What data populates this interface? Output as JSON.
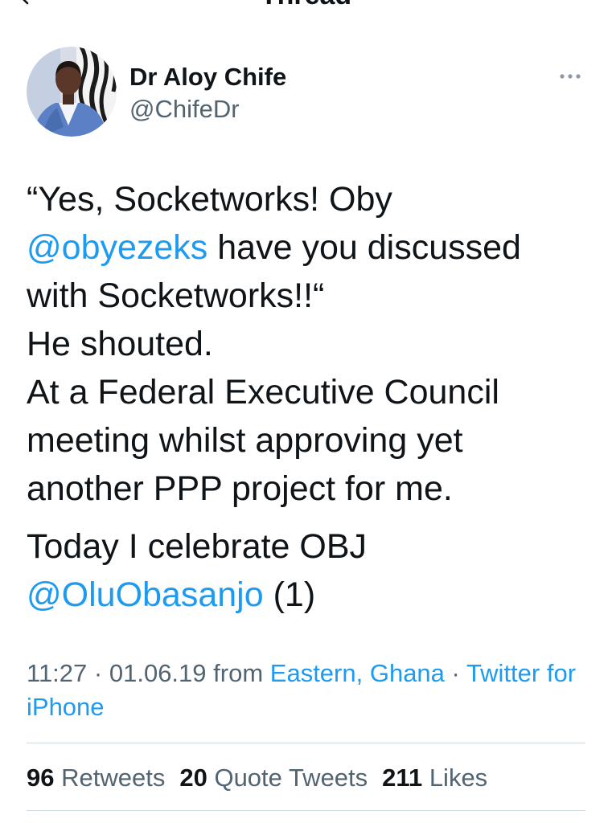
{
  "header": {
    "title": "Thread"
  },
  "author": {
    "name": "Dr Aloy Chife",
    "handle": "@ChifeDr"
  },
  "tweet": {
    "paragraph_1": {
      "line_1": "“Yes, Socketworks! Oby",
      "line_2_mention": "@obyezeks",
      "line_2_text": "have you discussed",
      "line_3": "with Socketworks!!“",
      "line_4": "He shouted.",
      "line_5": "At a Federal Executive Council",
      "line_6": "meeting whilst approving yet",
      "line_7": "another PPP project for me."
    },
    "paragraph_2": {
      "line_1": "Today I celebrate OBJ",
      "line_2_mention": "@OluObasanjo",
      "line_2_text": "(1)"
    }
  },
  "meta": {
    "time": "11:27",
    "separator": "·",
    "date": "01.06.19",
    "from_label": "from",
    "location": "Eastern, Ghana",
    "source": "Twitter for iPhone"
  },
  "stats": {
    "retweets": {
      "count": "96",
      "label": "Retweets"
    },
    "quote_tweets": {
      "count": "20",
      "label": "Quote Tweets"
    },
    "likes": {
      "count": "211",
      "label": "Likes"
    }
  },
  "icons": {
    "back": "back-arrow-icon",
    "more": "more-options-icon",
    "avatar": "avatar"
  },
  "colors": {
    "text": "#0f1419",
    "secondary": "#536471",
    "accent": "#1d9bf0",
    "divider": "#cfd9de"
  }
}
